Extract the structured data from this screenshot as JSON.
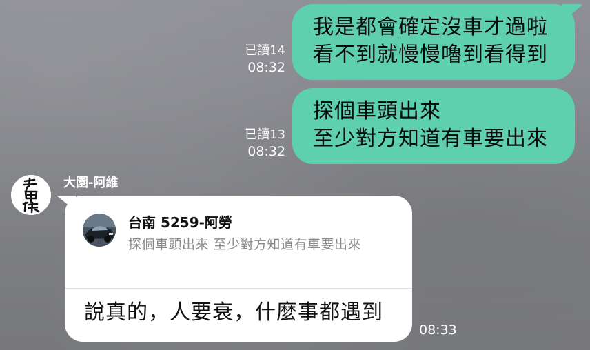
{
  "outgoing": [
    {
      "lines": [
        "我是都會確定沒車才過啦",
        "看不到就慢慢嚕到看得到"
      ],
      "read_status": "已讀14",
      "time": "08:32"
    },
    {
      "lines": [
        "探個車頭出來",
        "至少對方知道有車要出來"
      ],
      "read_status": "已讀13",
      "time": "08:32"
    }
  ],
  "incoming": {
    "sender_name": "大園-阿維",
    "avatar_icon": "calligraphy-avatar-icon",
    "reply_preview": {
      "name": "台南 5259-阿勞",
      "text": "探個車頭出來 至少對方知道有車要出來",
      "thumb_icon": "car-photo-icon"
    },
    "message": "說真的，人要衰，什麼事都遇到",
    "time": "08:33"
  },
  "colors": {
    "outgoing_bubble": "#5fd0ae",
    "incoming_bubble": "#ffffff",
    "background": "#86878c"
  }
}
